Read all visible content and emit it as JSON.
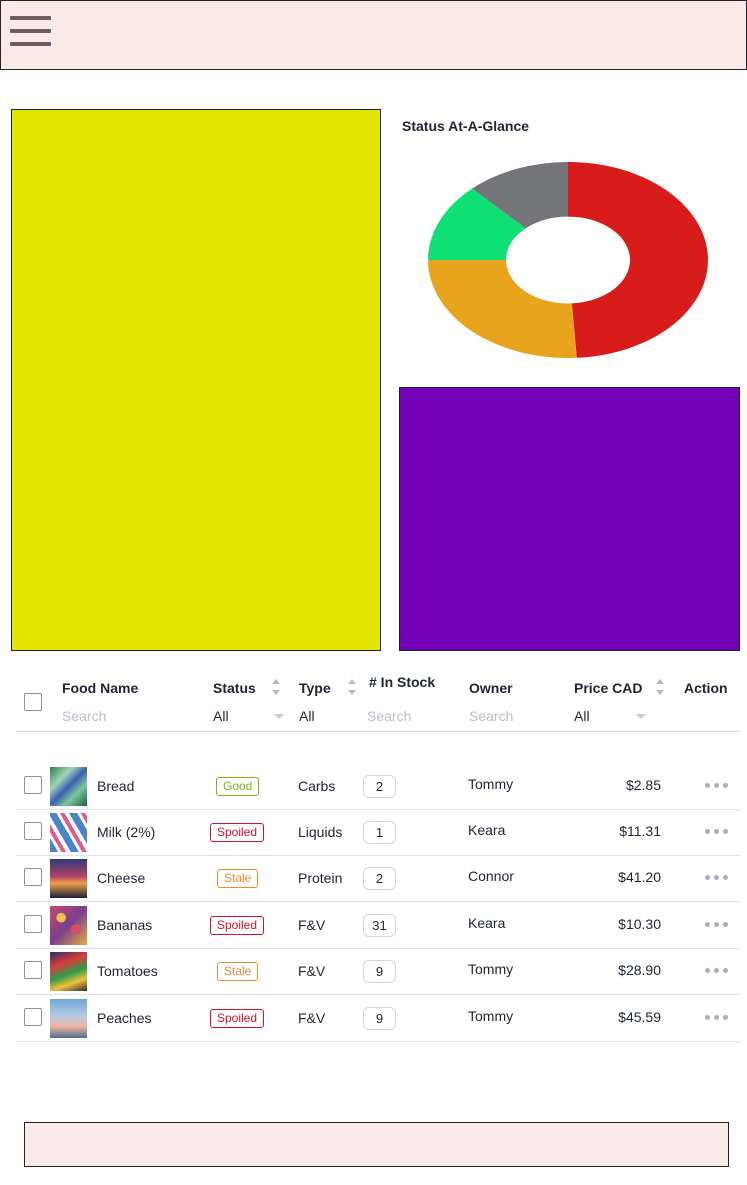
{
  "chart": {
    "title": "Status At-A-Glance"
  },
  "chart_data": {
    "type": "pie",
    "title": "Status At-A-Glance",
    "slices": [
      {
        "value": 49,
        "color": "#d81b1b"
      },
      {
        "value": 26,
        "color": "#e8a41c"
      },
      {
        "value": 13,
        "color": "#0ee076"
      },
      {
        "value": 12,
        "color": "#747578"
      }
    ]
  },
  "table": {
    "headers": {
      "food_name": "Food Name",
      "status": "Status",
      "type": "Type",
      "in_stock": "# In Stock",
      "owner": "Owner",
      "price": "Price CAD",
      "action": "Action"
    },
    "filters": {
      "food_name_placeholder": "Search",
      "status": "All",
      "type": "All",
      "in_stock_placeholder": "Search",
      "owner_placeholder": "Search",
      "price": "All"
    },
    "rows": [
      {
        "name": "Bread",
        "status": "Good",
        "type": "Carbs",
        "stock": "2",
        "owner": "Tommy",
        "price": "$2.85"
      },
      {
        "name": "Milk (2%)",
        "status": "Spoiled",
        "type": "Liquids",
        "stock": "1",
        "owner": "Keara",
        "price": "$11.31"
      },
      {
        "name": "Cheese",
        "status": "Stale",
        "type": "Protein",
        "stock": "2",
        "owner": "Connor",
        "price": "$41.20"
      },
      {
        "name": "Bananas",
        "status": "Spoiled",
        "type": "F&V",
        "stock": "31",
        "owner": "Keara",
        "price": "$10.30"
      },
      {
        "name": "Tomatoes",
        "status": "Stale",
        "type": "F&V",
        "stock": "9",
        "owner": "Tommy",
        "price": "$28.90"
      },
      {
        "name": "Peaches",
        "status": "Spoiled",
        "type": "F&V",
        "stock": "9",
        "owner": "Tommy",
        "price": "$45.59"
      }
    ]
  },
  "colors": {
    "good": "#7cb518",
    "spoiled": "#d0112b",
    "stale": "#ea8a34"
  },
  "icons": {
    "menu": "hamburger-icon",
    "row_action": "more-dots-icon"
  }
}
